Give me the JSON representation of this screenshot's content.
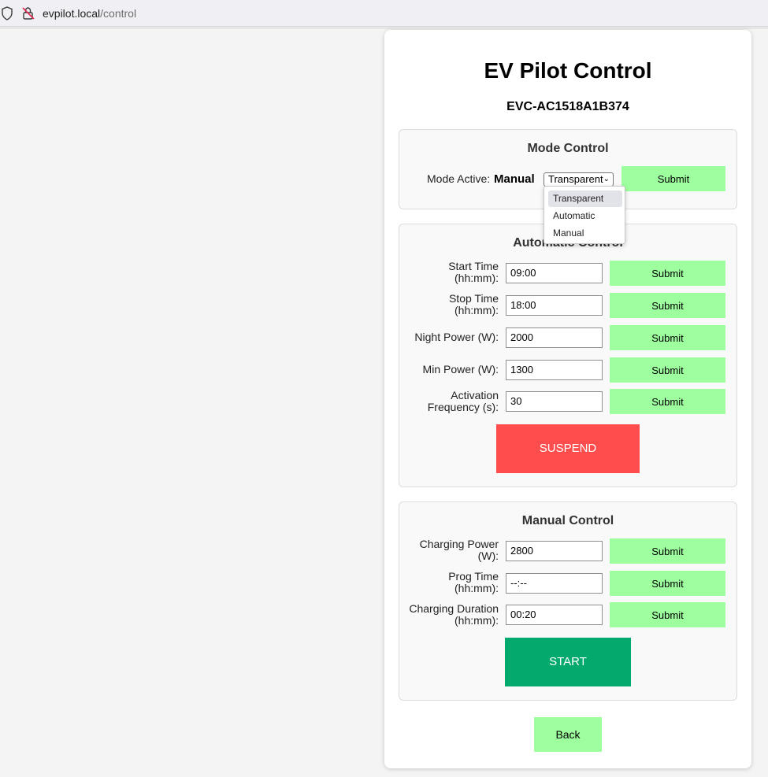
{
  "browser": {
    "url_host": "evpilot.local",
    "url_path": "/control"
  },
  "header": {
    "title": "EV Pilot Control",
    "device_id": "EVC-AC1518A1B374"
  },
  "mode_control": {
    "title": "Mode Control",
    "mode_label": "Mode Active:",
    "mode_value": "Manual",
    "selected": "Transparent",
    "options": [
      "Transparent",
      "Automatic",
      "Manual"
    ],
    "submit_label": "Submit"
  },
  "automatic_control": {
    "title": "Automatic Control",
    "fields": [
      {
        "label_line1": "Start Time",
        "label_line2": "(hh:mm):",
        "value": "09:00",
        "submit": "Submit"
      },
      {
        "label_line1": "Stop Time",
        "label_line2": "(hh:mm):",
        "value": "18:00",
        "submit": "Submit"
      },
      {
        "label_line1": "Night Power (W):",
        "label_line2": "",
        "value": "2000",
        "submit": "Submit"
      },
      {
        "label_line1": "Min Power (W):",
        "label_line2": "",
        "value": "1300",
        "submit": "Submit"
      },
      {
        "label_line1": "Activation",
        "label_line2": "Frequency (s):",
        "value": "30",
        "submit": "Submit"
      }
    ],
    "suspend_label": "SUSPEND"
  },
  "manual_control": {
    "title": "Manual Control",
    "fields": [
      {
        "label_line1": "Charging Power",
        "label_line2": "(W):",
        "value": "2800",
        "submit": "Submit"
      },
      {
        "label_line1": "Prog Time",
        "label_line2": "(hh:mm):",
        "value": "--:--",
        "submit": "Submit"
      },
      {
        "label_line1": "Charging Duration",
        "label_line2": "(hh:mm):",
        "value": "00:20",
        "submit": "Submit"
      }
    ],
    "start_label": "START"
  },
  "back_label": "Back",
  "colors": {
    "submit_bg": "#9dff9d",
    "suspend_bg": "#ff4d4d",
    "start_bg": "#04aa6d"
  }
}
